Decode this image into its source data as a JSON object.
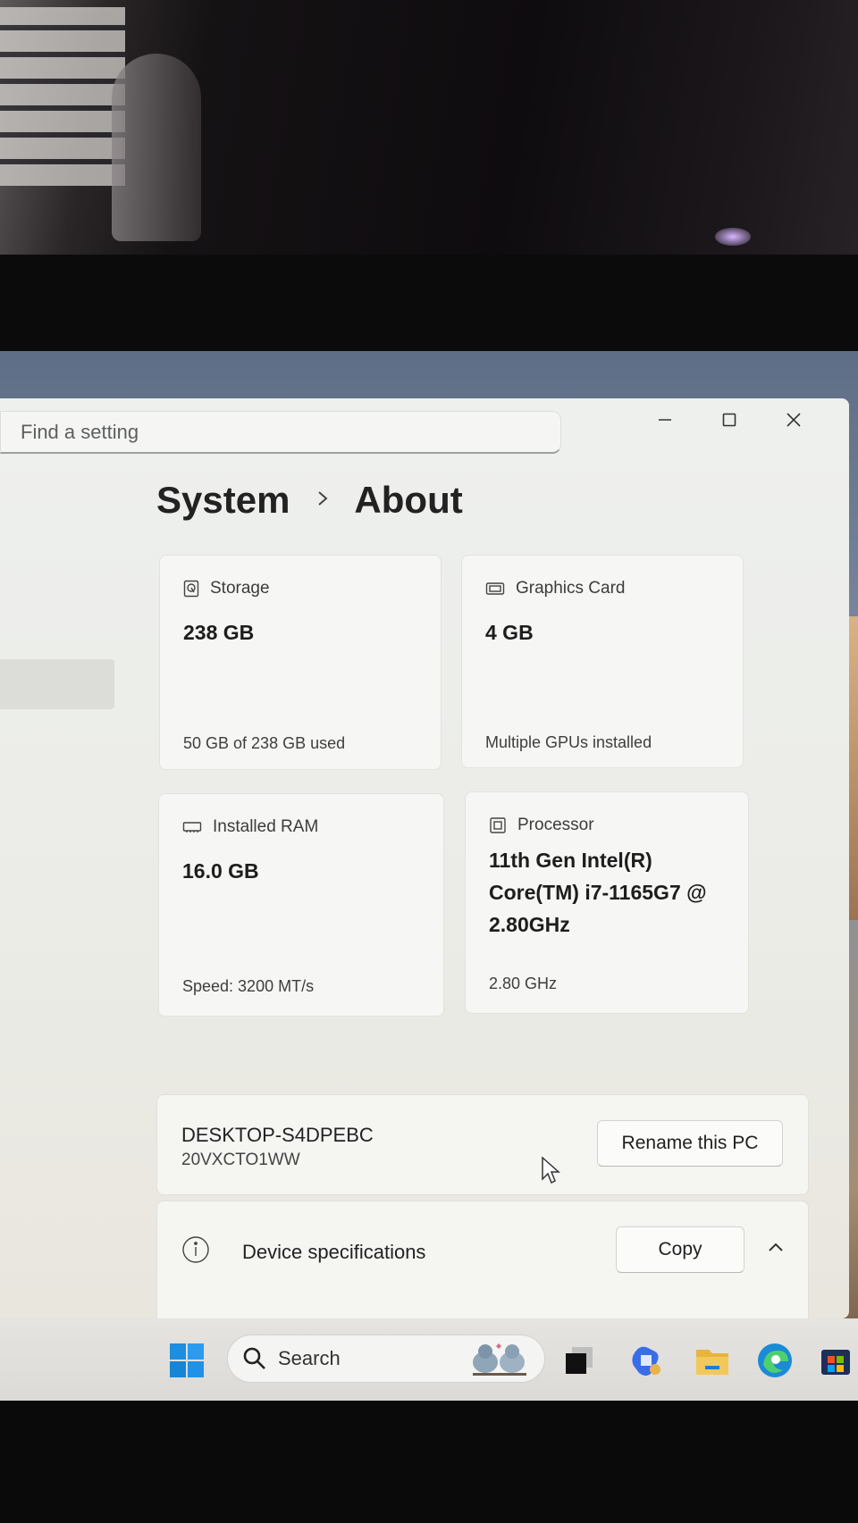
{
  "search": {
    "placeholder": "Find a setting"
  },
  "window_controls": [
    "minimize",
    "maximize",
    "close"
  ],
  "breadcrumb": {
    "parent": "System",
    "current": "About"
  },
  "cards": {
    "storage": {
      "label": "Storage",
      "value": "238 GB",
      "sub": "50 GB of 238 GB used"
    },
    "graphics": {
      "label": "Graphics Card",
      "value": "4 GB",
      "sub": "Multiple GPUs installed"
    },
    "ram": {
      "label": "Installed RAM",
      "value": "16.0 GB",
      "sub": "Speed: 3200 MT/s"
    },
    "processor": {
      "label": "Processor",
      "value_lines": [
        "11th Gen Intel(R)",
        "Core(TM) i7-1165G7 @",
        "2.80GHz"
      ],
      "sub": "2.80 GHz"
    }
  },
  "device": {
    "name": "DESKTOP-S4DPEBC",
    "model": "20VXCTO1WW",
    "rename_button": "Rename this PC"
  },
  "device_specs": {
    "title": "Device specifications",
    "copy_button": "Copy"
  },
  "taskbar": {
    "search_placeholder": "Search",
    "icons": [
      "windows-start-icon",
      "search-icon",
      "task-view-icon",
      "copilot-icon",
      "file-explorer-icon",
      "edge-icon",
      "microsoft-store-icon"
    ]
  },
  "colors": {
    "window_bg": "#eef0ee",
    "card_bg": "#f6f6f4",
    "text": "#1d1d1d"
  }
}
